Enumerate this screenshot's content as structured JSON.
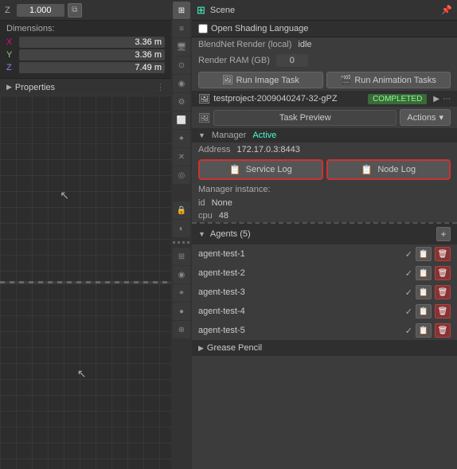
{
  "left_panel": {
    "z_label": "Z",
    "z_value": "1.000",
    "dimensions_title": "Dimensions:",
    "dim_x_label": "X",
    "dim_x_value": "3.36 m",
    "dim_y_label": "Y",
    "dim_y_value": "3.36 m",
    "dim_z_label": "Z",
    "dim_z_value": "7.49 m",
    "properties_label": "Properties"
  },
  "right_panel": {
    "title": "Scene",
    "open_shading_label": "Open Shading Language",
    "blendnet_label": "BlendNet Render (local)",
    "blendnet_status": "idle",
    "ram_label": "Render RAM (GB)",
    "ram_value": "0",
    "run_image_label": "Run Image Task",
    "run_animation_label": "Run Animation Tasks",
    "task_name": "testproject-2009040247-32-gPZ",
    "task_status": "COMPLETED",
    "task_preview_label": "Task Preview",
    "actions_label": "Actions",
    "chevron_down": "▾",
    "manager_label": "Manager",
    "manager_status": "Active",
    "address_label": "Address",
    "address_value": "172.17.0.3:8443",
    "service_log_label": "Service Log",
    "node_log_label": "Node Log",
    "instance_label": "Manager instance:",
    "id_label": "id",
    "id_value": "None",
    "cpu_label": "cpu",
    "cpu_value": "48",
    "agents_label": "Agents (5)",
    "add_btn_label": "+",
    "agents": [
      {
        "name": "agent-test-1"
      },
      {
        "name": "agent-test-2"
      },
      {
        "name": "agent-test-3"
      },
      {
        "name": "agent-test-4"
      },
      {
        "name": "agent-test-5"
      }
    ],
    "grease_pencil_label": "Grease Pencil"
  },
  "sidebar": {
    "icons": [
      "⊞",
      "≡",
      "🖥",
      "⊙",
      "🔴",
      "⚙",
      "🔲",
      "✿",
      "⊗",
      "◎",
      "🔒",
      "◐"
    ]
  }
}
